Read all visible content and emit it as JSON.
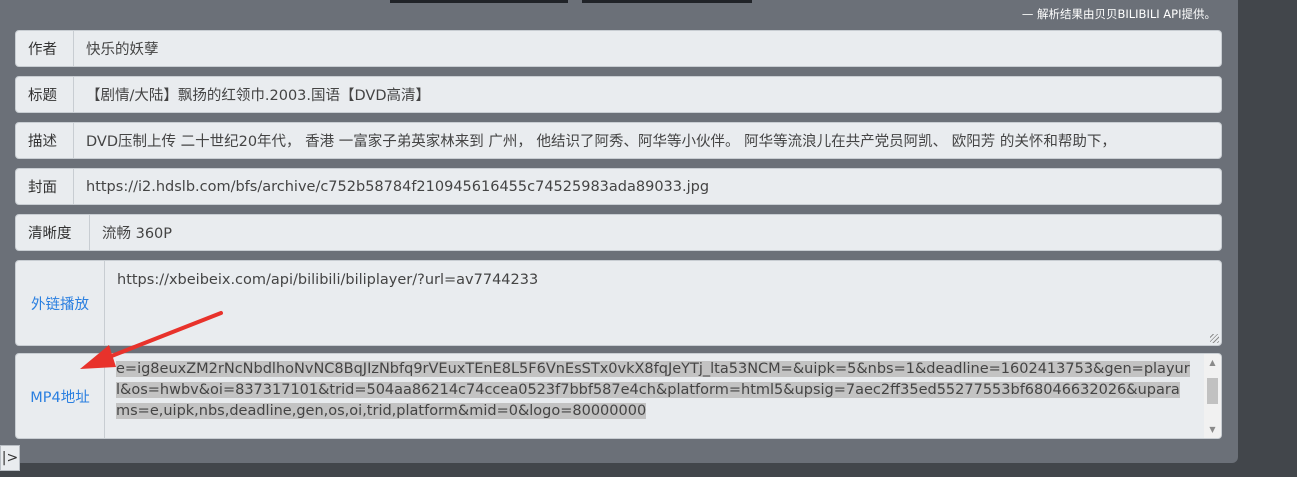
{
  "attribution": "— 解析结果由贝贝BILIBILI API提供。",
  "fields": [
    {
      "label": "作者",
      "value": "快乐的妖孽"
    },
    {
      "label": "标题",
      "value": "【剧情/大陆】飘扬的红领巾.2003.国语【DVD高清】"
    },
    {
      "label": "描述",
      "value": "DVD压制上传 二十世纪20年代， 香港 一富家子弟英家林来到 广州， 他结识了阿秀、阿华等小伙伴。 阿华等流浪儿在共产党员阿凯、 欧阳芳 的关怀和帮助下，"
    },
    {
      "label": "封面",
      "value": "https://i2.hdslb.com/bfs/archive/c752b58784f210945616455c74525983ada89033.jpg"
    },
    {
      "label": "清晰度",
      "value": "流畅 360P"
    }
  ],
  "embed": {
    "label": "外链播放",
    "value": "https://xbeibeix.com/api/bilibili/biliplayer/?url=av7744233"
  },
  "mp4": {
    "label": "MP4地址",
    "text": "e=ig8euxZM2rNcNbdlhoNvNC8BqJIzNbfq9rVEuxTEnE8L5F6VnEsSTx0vkX8fqJeYTj_lta53NCM=&uipk=5&nbs=1&deadline=1602413753&gen=playurl&os=hwbv&oi=837317101&trid=504aa86214c74ccea0523f7bbf587e4ch&platform=html5&upsig=7aec2ff35ed55277553bf68046632026&uparams=e,uipk,nbs,deadline,gen,os,oi,trid,platform&mid=0&logo=80000000"
  },
  "corner_button": "|>",
  "colors": {
    "link": "#2a7fe0",
    "arrow": "#e8322b",
    "selection": "#c3c3c3"
  }
}
